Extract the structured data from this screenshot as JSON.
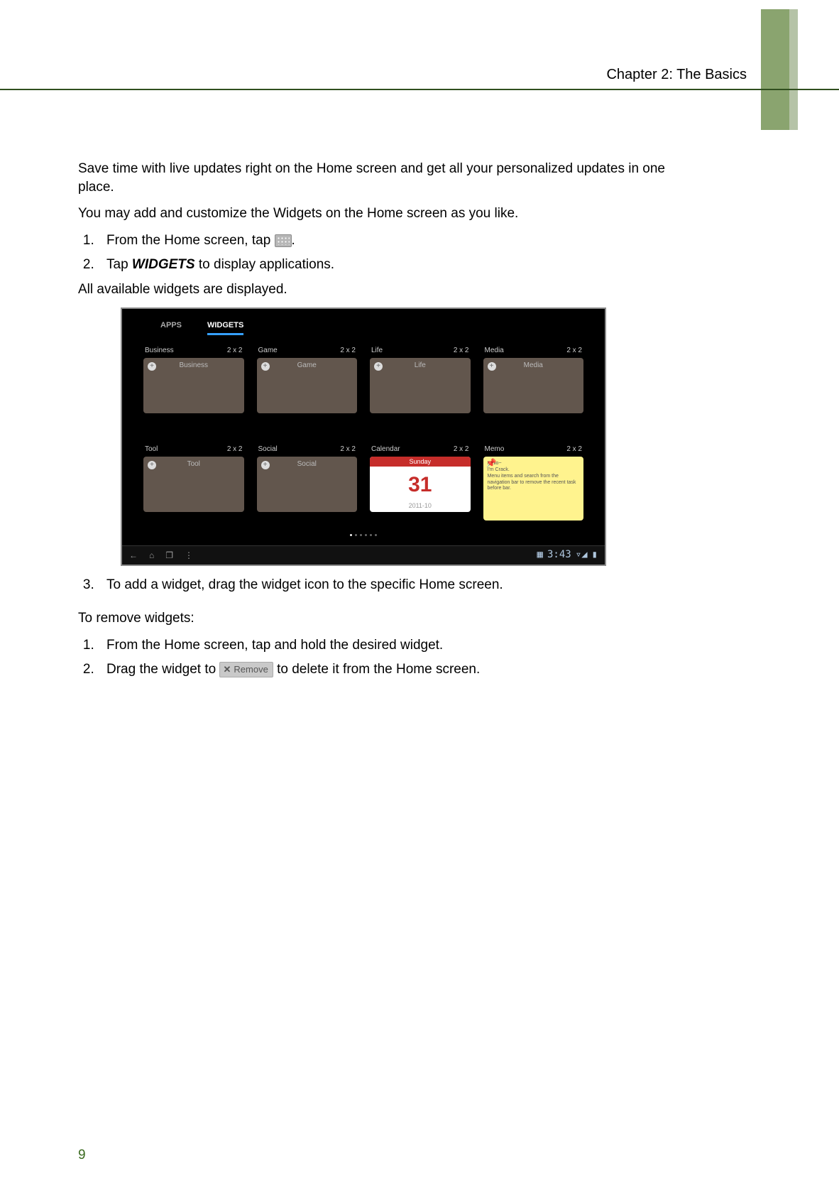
{
  "header": {
    "chapter": "Chapter 2: The Basics"
  },
  "intro": {
    "p1": "Save time with live updates right on the Home screen and get all your personalized updates in one place.",
    "p2": "You may add and customize the Widgets on the Home screen as you like."
  },
  "add_steps": {
    "s1_pre": "From the Home screen, tap ",
    "s1_post": ".",
    "s2_pre": "Tap ",
    "s2_word": "WIDGETS",
    "s2_post": " to display applications.",
    "s2_sub": "All available widgets are displayed.",
    "s3": "To add a widget, drag the widget icon to the specific Home screen."
  },
  "remove": {
    "heading": "To remove widgets:",
    "s1": "From the Home screen, tap and hold the desired widget.",
    "s2_pre": "Drag the widget to",
    "s2_chip_x": "✕",
    "s2_chip_label": "Remove",
    "s2_post": " to delete it from the Home screen."
  },
  "screenshot": {
    "tabs": {
      "apps": "APPS",
      "widgets": "WIDGETS"
    },
    "size_label": "2 x 2",
    "widgets": [
      {
        "title": "Business",
        "caption": "Business",
        "kind": "plain"
      },
      {
        "title": "Game",
        "caption": "Game",
        "kind": "plain"
      },
      {
        "title": "Life",
        "caption": "Life",
        "kind": "plain"
      },
      {
        "title": "Media",
        "caption": "Media",
        "kind": "plain"
      },
      {
        "title": "Tool",
        "caption": "Tool",
        "kind": "plain"
      },
      {
        "title": "Social",
        "caption": "Social",
        "kind": "plain"
      },
      {
        "title": "Calendar",
        "caption": "",
        "kind": "calendar"
      },
      {
        "title": "Memo",
        "caption": "",
        "kind": "memo"
      }
    ],
    "calendar": {
      "weekday": "Sunday",
      "day": "31",
      "date": "2011-10"
    },
    "memo_text": "Hello~\nI'm Crack.\nMenu items and search from the navigation bar to remove the recent task before bar.",
    "statusbar": {
      "time": "3:43"
    }
  },
  "page_number": "9"
}
